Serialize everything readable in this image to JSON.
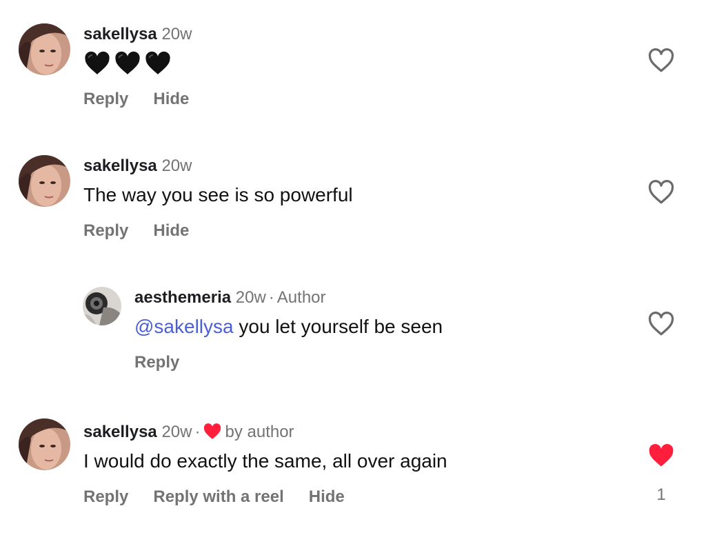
{
  "comments": [
    {
      "username": "sakellysa",
      "time": "20w",
      "text": "🖤🖤🖤",
      "actions": [
        "Reply",
        "Hide"
      ],
      "liked": false
    },
    {
      "username": "sakellysa",
      "time": "20w",
      "text": "The way you see is so powerful",
      "actions": [
        "Reply",
        "Hide"
      ],
      "liked": false
    },
    {
      "username": "aesthemeria",
      "time": "20w",
      "separator": "·",
      "author_label": "Author",
      "mention": "@sakellysa",
      "text": " you let yourself be seen",
      "actions": [
        "Reply"
      ],
      "liked": false
    },
    {
      "username": "sakellysa",
      "time": "20w",
      "separator": "·",
      "liked_by_label": "by author",
      "text": "I would do exactly the same, all over again",
      "actions": [
        "Reply",
        "Reply with a reel",
        "Hide"
      ],
      "liked": true,
      "like_count": "1"
    }
  ],
  "colors": {
    "liked_heart": "#ff1f3d",
    "mention": "#4a5fd6",
    "secondary_text": "#737373"
  },
  "icons": {
    "like_outline": "heart-outline-icon",
    "like_filled": "heart-filled-icon",
    "black_heart": "black-heart-emoji"
  }
}
